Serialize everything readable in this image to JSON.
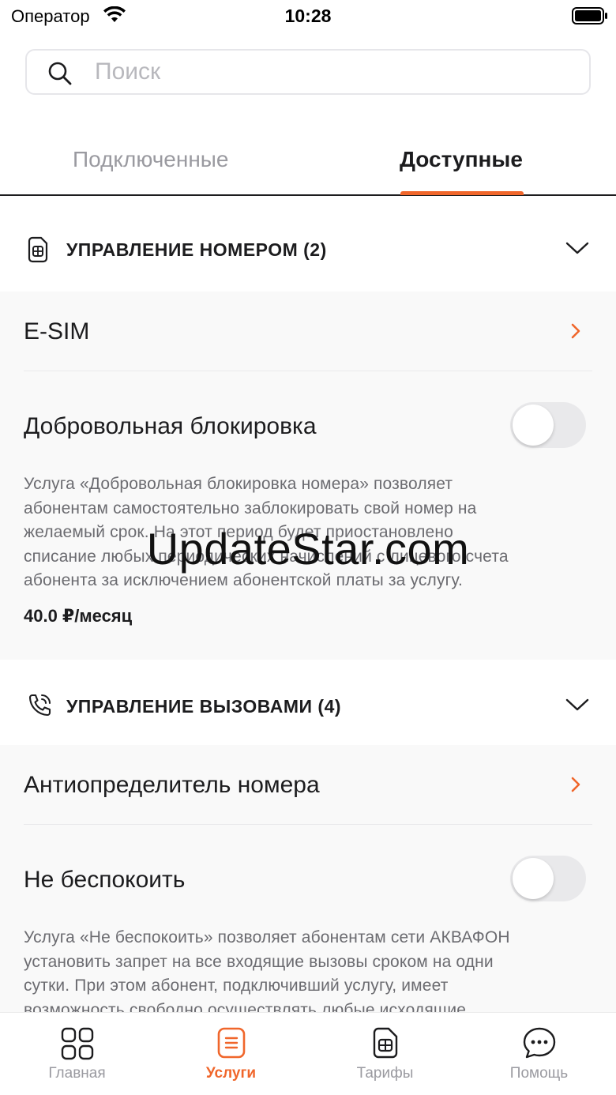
{
  "status_bar": {
    "carrier": "Оператор",
    "time": "10:28"
  },
  "search": {
    "placeholder": "Поиск",
    "value": ""
  },
  "tabs": [
    {
      "label": "Подключенные",
      "active": false
    },
    {
      "label": "Доступные",
      "active": true
    }
  ],
  "groups": [
    {
      "title": "УПРАВЛЕНИЕ НОМЕРОМ (2)",
      "icon": "sim-card-icon",
      "items": [
        {
          "type": "link",
          "label": "E-SIM"
        },
        {
          "type": "toggle",
          "label": "Добровольная блокировка",
          "enabled": false,
          "description": [
            "Услуга «Добровольная блокировка номера» позволяет",
            "абонентам самостоятельно заблокировать свой номер  на",
            "желаемый срок.  На этот период будет приостановлено",
            "списание любых периодических начислений с лицевого счета",
            "абонента за исключением абонентской платы за услугу."
          ],
          "price": "40.0 ₽/месяц"
        }
      ]
    },
    {
      "title": "УПРАВЛЕНИЕ ВЫЗОВАМИ (4)",
      "icon": "phone-call-icon",
      "items": [
        {
          "type": "link",
          "label": "Антиопределитель номера"
        },
        {
          "type": "toggle",
          "label": "Не беспокоить",
          "enabled": false,
          "description": [
            "Услуга «Не беспокоить» позволяет абонентам сети АКВАФОН",
            "установить запрет на все входящие вызовы сроком на одни",
            "сутки. При этом абонент, подключивший услугу, имеет",
            "возможность свободно осуществлять любые исходящие"
          ]
        }
      ]
    }
  ],
  "watermark": "UpdateStar.com",
  "bottom_nav": [
    {
      "label": "Главная",
      "icon": "grid-icon",
      "active": false
    },
    {
      "label": "Услуги",
      "icon": "services-icon",
      "active": true
    },
    {
      "label": "Тарифы",
      "icon": "sim-card-icon",
      "active": false
    },
    {
      "label": "Помощь",
      "icon": "chat-bubble-icon",
      "active": false
    }
  ],
  "colors": {
    "accent": "#f0662b",
    "text": "#1c1c1e",
    "muted": "#9a9aa0",
    "section_bg": "#f9f9f9"
  }
}
